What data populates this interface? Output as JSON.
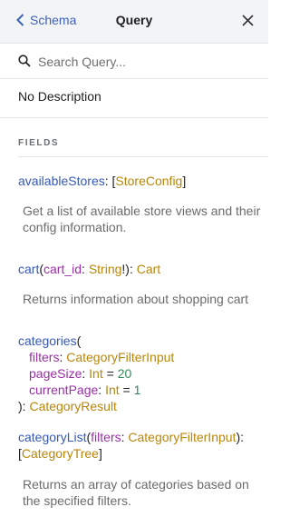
{
  "header": {
    "back_label": "Schema",
    "title": "Query"
  },
  "search": {
    "placeholder": "Search Query..."
  },
  "type_description": "No Description",
  "section_title": "FIELDS",
  "fields": {
    "available_stores": {
      "name": "availableStores",
      "type": "StoreConfig",
      "description": "Get a list of available store views and their config information."
    },
    "cart": {
      "name": "cart",
      "arg": "cart_id",
      "arg_type": "String",
      "return_type": "Cart",
      "description": "Returns information about shopping cart"
    },
    "categories": {
      "name": "categories",
      "args": [
        {
          "name": "filters",
          "type": "CategoryFilterInput",
          "default": ""
        },
        {
          "name": "pageSize",
          "type": "Int",
          "default": "20"
        },
        {
          "name": "currentPage",
          "type": "Int",
          "default": "1"
        }
      ],
      "return_type": "CategoryResult"
    },
    "category_list": {
      "name": "categoryList",
      "arg": "filters",
      "arg_type": "CategoryFilterInput",
      "return_type": "CategoryTree",
      "description": "Returns an array of categories based on the specified filters."
    }
  },
  "colors": {
    "field": "#3659b8",
    "type": "#b8860b",
    "arg": "#9c2fa8",
    "default_value": "#2e8b57"
  }
}
